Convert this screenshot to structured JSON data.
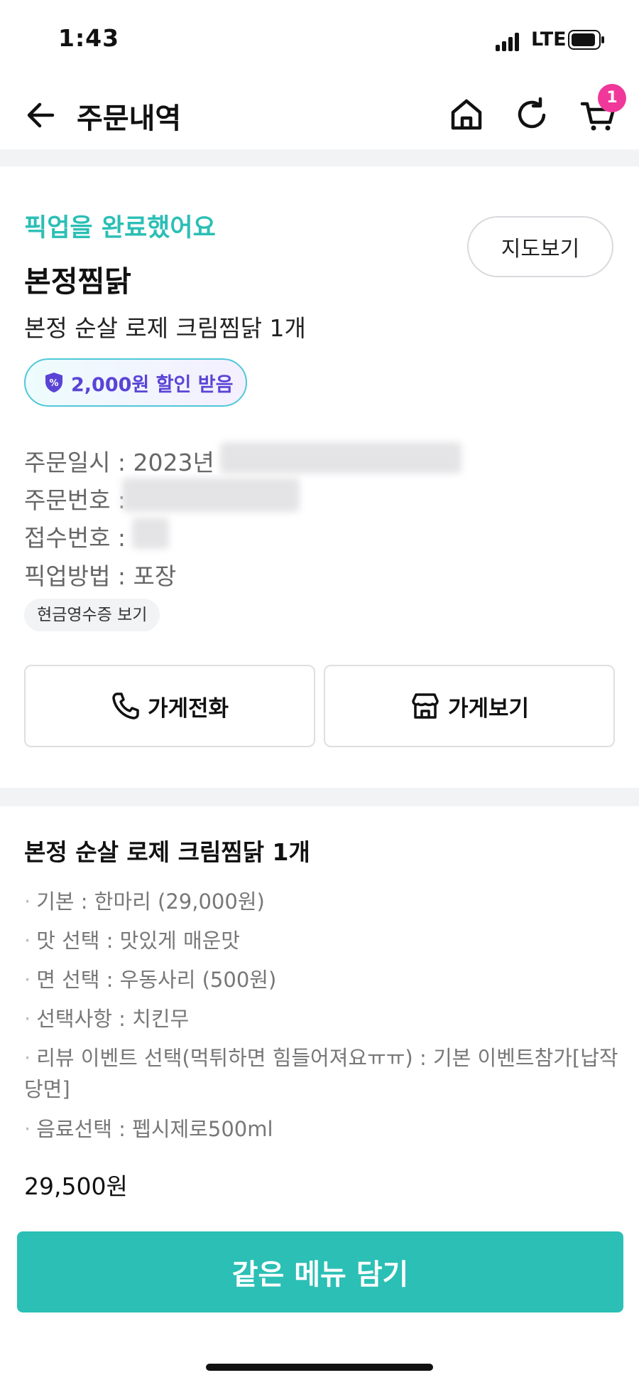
{
  "status_bar": {
    "time": "1:43",
    "network": "LTE"
  },
  "header": {
    "title": "주문내역",
    "cart_count": "1"
  },
  "order": {
    "status": "픽업을 완료했어요",
    "map_button": "지도보기",
    "store_name": "본정찜닭",
    "summary": "본정 순살 로제 크림찜닭 1개",
    "discount": "2,000원 할인 받음",
    "info": {
      "order_date_label": "주문일시 : 2023년",
      "order_number_label": "주문번호 :",
      "receipt_number_label": "접수번호 :",
      "pickup_method": "픽업방법 : 포장"
    },
    "receipt_chip": "현금영수증 보기",
    "call_store": "가게전화",
    "view_store": "가게보기"
  },
  "menu_detail": {
    "title": "본정 순살 로제 크림찜닭 1개",
    "options": [
      "기본 : 한마리 (29,000원)",
      "맛 선택 : 맛있게 매운맛",
      "면 선택 : 우동사리 (500원)",
      "선택사항 : 치킨무",
      "리뷰 이벤트 선택(먹튀하면 힘들어져요ㅠㅠ) : 기본 이벤트참가[납작당면]",
      "음료선택 : 펩시제로500ml"
    ],
    "price": "29,500원"
  },
  "cta": "같은 메뉴 담기",
  "colors": {
    "accent": "#2bbfb5",
    "badge": "#f0389b",
    "discount_text": "#5a44d6"
  }
}
